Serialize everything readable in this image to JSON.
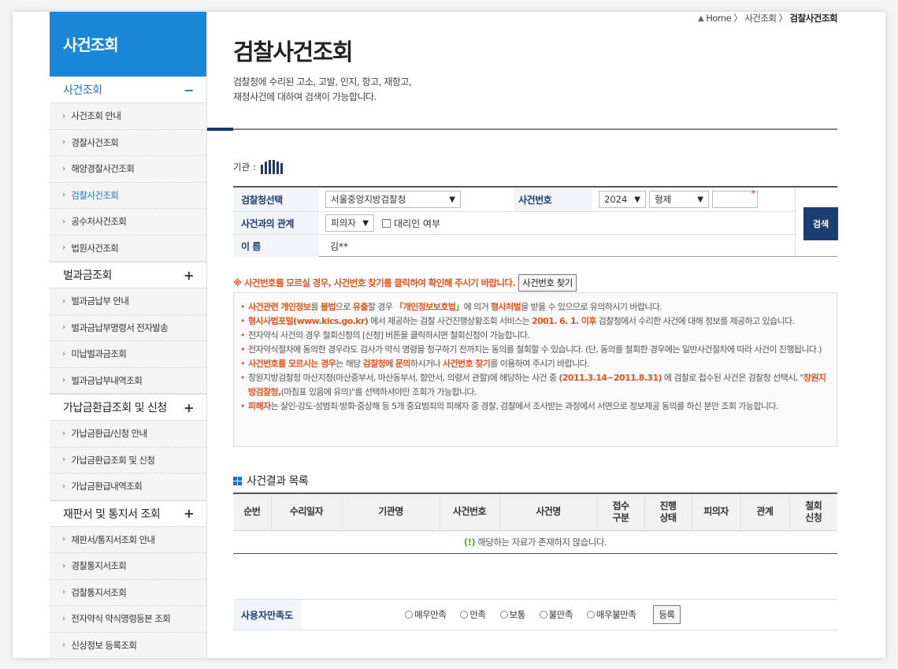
{
  "sidebar": {
    "title": "사건조회",
    "groups": [
      {
        "label": "사건조회",
        "sign": "−",
        "active": true,
        "items": [
          "사건조회 안내",
          "경찰사건조회",
          "해양경찰사건조회",
          "검찰사건조회",
          "공수처사건조회",
          "법원사건조회"
        ]
      },
      {
        "label": "벌과금조회",
        "sign": "+",
        "items": [
          "벌과금납부 안내",
          "벌과금납부명령서 전자발송",
          "미납벌과금조회",
          "벌과금납부내역조회"
        ]
      },
      {
        "label": "가납금환급조회 및 신청",
        "sign": "+",
        "items": [
          "가납금환급/신청 안내",
          "가납금환급조회 및 신청",
          "가납금환급내역조회"
        ]
      },
      {
        "label": "재판서 및 통지서 조회",
        "sign": "+",
        "items": [
          "재판서/통지서조회 안내",
          "경찰통지서조회",
          "검찰통지서조회",
          "전자약식 약식명령등본 조회",
          "신상정보 등록조회"
        ]
      }
    ]
  },
  "breadcrumb": {
    "home": "Home",
    "sep": "〉",
    "parent": "사건조회",
    "current": "검찰사건조회"
  },
  "page": {
    "title": "검찰사건조회",
    "desc_line1": "검찰청에 수리된 고소, 고발, 인지, 항고, 재항고,",
    "desc_line2": "재정사건에 대하여 검색이 가능합니다."
  },
  "agency_label": "기관 :",
  "form": {
    "office_label": "검찰청선택",
    "office_value": "서울중앙지방검찰청",
    "case_no_label": "사건번호",
    "year_value": "2024",
    "type_value": "형제",
    "relation_label": "사건과의 관계",
    "relation_value": "피의자",
    "proxy_label": "대리인 여부",
    "name_label": "이 름",
    "name_value": "김**",
    "search_button": "검색"
  },
  "warning": {
    "text": "※ 사건번호를 모르실 경우, 사건번호 찾기를 클릭하여 확인해 주시기 바랍니다.",
    "button": "사건번호 찾기"
  },
  "notice": {
    "n1_a": "사건관련 개인정보",
    "n1_b": "를 ",
    "n1_c": "불법",
    "n1_d": "으로 ",
    "n1_e": "유출",
    "n1_f": "할 경우 ",
    "n1_g": "「개인정보보호법」",
    "n1_h": "에 의거 ",
    "n1_i": "형사처벌",
    "n1_j": "을 받을 수 있으므로 유의하시기 바랍니다.",
    "n2_a": "형사사법포털(www.kics.go.kr)",
    "n2_b": " 에서 제공하는 검찰 사건진행상황조회 서비스는 ",
    "n2_c": "2001. 6. 1. 이후",
    "n2_d": " 검찰청에서 수리한 사건에 대해 정보를 제공하고 있습니다.",
    "n3": "전자약식 사건의 경우 철회신청의 [신청] 버튼을 클릭하시면 철회신청이 가능합니다.",
    "n4": "전자약식절차에 동의한 경우라도 검사가 약식 명령을 청구하기 전까지는 동의를 철회할 수 있습니다. (단, 동의를 철회한 경우에는 일반사건절차에 따라 사건이 진행됩니다.)",
    "n5_a": "사건번호를 모르시는 경우",
    "n5_b": "는 해당 ",
    "n5_c": "검찰청에 문의",
    "n5_d": "하시거나 ",
    "n5_e": "사건번호 찾기",
    "n5_f": "를 이용하여 주시기 바랍니다.",
    "n6_a": "창원지방검찰청 마산지청(마산중부서, 마산동부서, 함안서, 의령서 관할)에 해당하는 사건 중 ",
    "n6_b": "(2011.3.14~2011.8.31)",
    "n6_c": " 에 검찰로 접수된 사건은 검찰청 선택시, \"",
    "n6_d": "창원지방검찰청,",
    "n6_e": "(마침표 있음에 유의)\"를 선택하셔야만 조회가 가능합니다.",
    "n7_a": "피해자",
    "n7_b": "는 살인·강도·성범죄·방화·중상해 등 5개 중요범죄의 피해자 중 경찰, 검찰에서 조사받는 과정에서 서면으로 정보제공 동의를 하신 분만 조회 가능합니다."
  },
  "results": {
    "title": "사건결과 목록",
    "columns": [
      "순번",
      "수리일자",
      "기관명",
      "사건번호",
      "사건명",
      "접수\n구분",
      "진행\n상태",
      "피의자",
      "관계",
      "철회\n신청"
    ],
    "empty_mark": "(!)",
    "empty_text": " 해당하는 자료가 존재하지 않습니다."
  },
  "survey": {
    "label": "사용자만족도",
    "options": [
      "매우만족",
      "만족",
      "보통",
      "불만족",
      "매우불만족"
    ],
    "submit": "등록"
  },
  "colors": {
    "sidebar_head": "#1a86d6",
    "navy": "#1a3d73",
    "accent_orange": "#e0541e",
    "link_blue": "#1a74c6"
  }
}
